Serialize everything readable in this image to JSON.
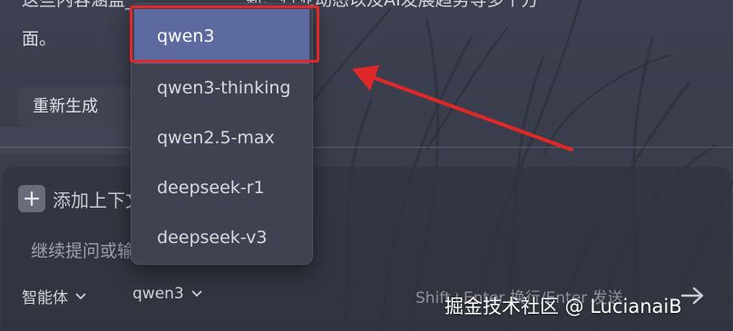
{
  "answer": {
    "line1": "这些内容涵盖______________新、行业动态以及AI发展趋势等多个方",
    "line2": "面。"
  },
  "regenerate_label": "重新生成",
  "composer": {
    "add_context_label": "添加上下文",
    "input_placeholder": "继续提问或输入指令",
    "agent_label": "智能体",
    "model_label": "qwen3",
    "shortcut_hint": "Shift+Enter 换行/Enter 发送"
  },
  "model_dropdown": {
    "selected": "qwen3",
    "options": [
      "qwen3",
      "qwen3-thinking",
      "qwen2.5-max",
      "deepseek-r1",
      "deepseek-v3"
    ]
  },
  "watermark": "掘金技术社区 @ LucianaiB",
  "colors": {
    "selected_item": "#5d6a9f",
    "annotation_red": "#e02828",
    "panel": "#3f4250"
  },
  "icons": {
    "add": "plus-icon",
    "chevron": "chevron-down-icon",
    "send": "arrow-right-icon"
  }
}
